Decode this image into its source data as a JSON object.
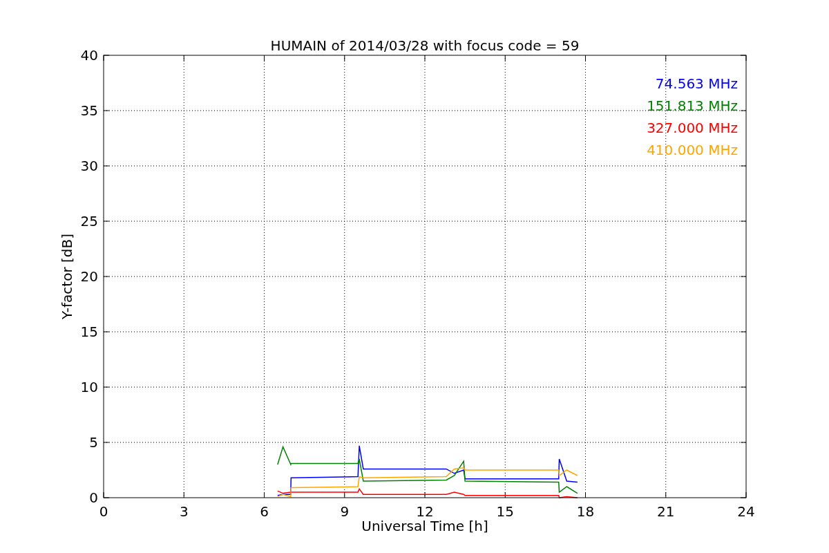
{
  "chart_data": {
    "type": "line",
    "title": "HUMAIN of 2014/03/28 with focus code = 59",
    "xlabel": "Universal Time [h]",
    "ylabel": "Y-factor [dB]",
    "x": [
      6.5,
      6.7,
      6.99,
      7.0,
      9.5,
      9.55,
      9.7,
      12.8,
      13.1,
      13.45,
      13.5,
      17.0,
      17.02,
      17.3,
      17.7
    ],
    "series": [
      {
        "name": "74.563 MHz",
        "color": "#0000ff",
        "values": [
          0.2,
          0.3,
          0.3,
          1.8,
          1.9,
          4.7,
          2.6,
          2.6,
          2.2,
          2.5,
          1.7,
          1.7,
          3.5,
          1.5,
          1.4
        ]
      },
      {
        "name": "151.813 MHz",
        "color": "#008000",
        "values": [
          3.0,
          4.6,
          3.0,
          3.1,
          3.1,
          3.5,
          1.5,
          1.6,
          2.0,
          3.3,
          1.5,
          1.4,
          0.5,
          1.0,
          0.4
        ]
      },
      {
        "name": "327.000 MHz",
        "color": "#ff0000",
        "values": [
          0.6,
          0.4,
          0.5,
          0.5,
          0.5,
          0.8,
          0.3,
          0.3,
          0.5,
          0.3,
          0.2,
          0.2,
          0.0,
          0.1,
          0.0
        ]
      },
      {
        "name": "410.000 MHz",
        "color": "#ffa500",
        "values": [
          0.1,
          0.3,
          0.1,
          0.9,
          1.0,
          1.9,
          1.8,
          1.9,
          2.6,
          2.7,
          2.5,
          2.5,
          2.0,
          2.5,
          2.0
        ]
      }
    ],
    "xlim": [
      0,
      24
    ],
    "ylim": [
      0,
      40
    ],
    "xticks": [
      0,
      3,
      6,
      9,
      12,
      15,
      18,
      21,
      24
    ],
    "yticks": [
      0,
      5,
      10,
      15,
      20,
      25,
      30,
      35,
      40
    ],
    "grid": true
  }
}
